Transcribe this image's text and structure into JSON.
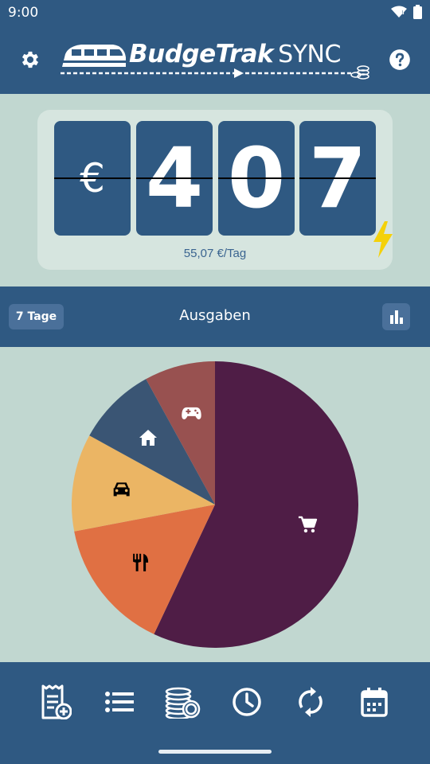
{
  "status_bar": {
    "time": "9:00"
  },
  "header": {
    "logo_name": "BudgeTrak",
    "logo_suffix": "SYNC",
    "settings_icon": "gear-icon",
    "help_icon": "help-circle-icon"
  },
  "counter": {
    "digits": [
      "€",
      "4",
      "0",
      "7"
    ],
    "daily_rate": "55,07 €/Tag",
    "bolt_color": "#f4d10b"
  },
  "section": {
    "period_label": "7 Tage",
    "title": "Ausgaben",
    "chart_toggle_icon": "bar-chart-icon"
  },
  "chart_data": {
    "type": "pie",
    "title": "",
    "slices": [
      {
        "icon": "shopping-cart-icon",
        "value": 57,
        "color": "#4f1d46"
      },
      {
        "icon": "restaurant-icon",
        "value": 15,
        "color": "#e07043"
      },
      {
        "icon": "car-icon",
        "value": 11,
        "color": "#ebb564"
      },
      {
        "icon": "home-icon",
        "value": 9,
        "color": "#3a5574"
      },
      {
        "icon": "gamepad-icon",
        "value": 8,
        "color": "#985150"
      }
    ]
  },
  "bottom_nav": {
    "items": [
      {
        "icon": "add-receipt-icon"
      },
      {
        "icon": "list-icon"
      },
      {
        "icon": "coins-icon"
      },
      {
        "icon": "clock-icon"
      },
      {
        "icon": "sync-icon"
      },
      {
        "icon": "calendar-icon"
      }
    ]
  },
  "colors": {
    "primary": "#2f5982",
    "background": "#c1d7d0",
    "card": "#d6e5df",
    "button": "#4a709a"
  }
}
